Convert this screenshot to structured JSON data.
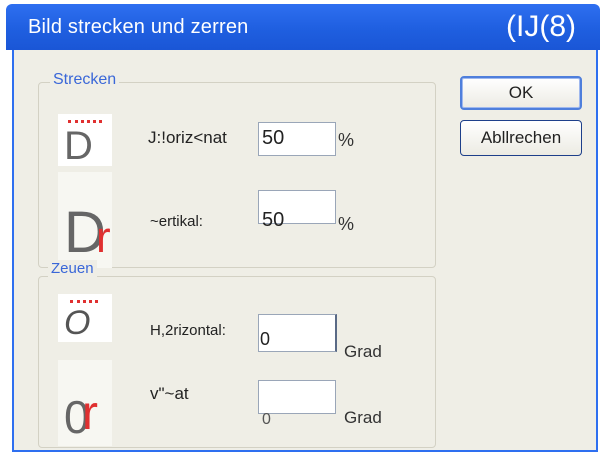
{
  "window": {
    "title": "Bild strecken und zerren",
    "title_right": "(IJ(8)"
  },
  "strecken": {
    "group_label": "Strecken",
    "horizontal": {
      "label": "J:!oriz<nat",
      "value": "50",
      "unit": "%"
    },
    "vertikal": {
      "label": "~ertikal:",
      "value": "50",
      "unit": "%"
    },
    "preview_h": {
      "letter": "D"
    },
    "preview_v": {
      "letter": "D",
      "letter2": "r"
    }
  },
  "zerren": {
    "group_label": "Zeuen",
    "horizontal": {
      "label": "H,2rizontal:",
      "value": "0",
      "unit": "Grad"
    },
    "vertikal": {
      "label": "v\"~at",
      "value": "0",
      "unit": "Grad"
    },
    "preview_h": {
      "letter": "O"
    },
    "preview_v": {
      "letter": "0",
      "letter2": "r"
    }
  },
  "buttons": {
    "ok_label": "OK",
    "cancel_label": "Abllrechen"
  },
  "colors": {
    "title_bar": "#1f5fe0",
    "dialog_bg": "#efeee6",
    "group_label": "#3a67d8",
    "accent_red": "#e03030"
  }
}
